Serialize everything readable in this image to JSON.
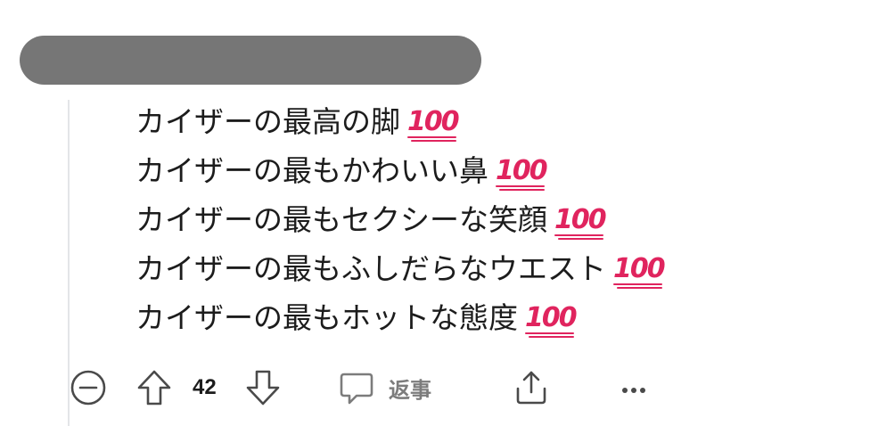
{
  "comment": {
    "lines": [
      {
        "text": "カイザーの最高の脚",
        "emoji": "100"
      },
      {
        "text": "カイザーの最もかわいい鼻",
        "emoji": "100"
      },
      {
        "text": "カイザーの最もセクシーな笑顔",
        "emoji": "100"
      },
      {
        "text": "カイザーの最もふしだらなウエスト",
        "emoji": "100"
      },
      {
        "text": "カイザーの最もホットな態度",
        "emoji": "100"
      }
    ]
  },
  "actions": {
    "collapse_icon": "minus-circle-icon",
    "upvote_icon": "arrow-up-outline-icon",
    "vote_count": "42",
    "downvote_icon": "arrow-down-outline-icon",
    "reply_icon": "speech-bubble-icon",
    "reply_label": "返事",
    "share_icon": "share-upload-icon",
    "more_icon": "more-dots-icon"
  },
  "colors": {
    "redaction": "#767676",
    "emoji_red": "#e0245e",
    "icon_gray": "#4a4a4a",
    "reply_gray": "#7c7c7c",
    "thread_line": "#e3e5e8"
  }
}
